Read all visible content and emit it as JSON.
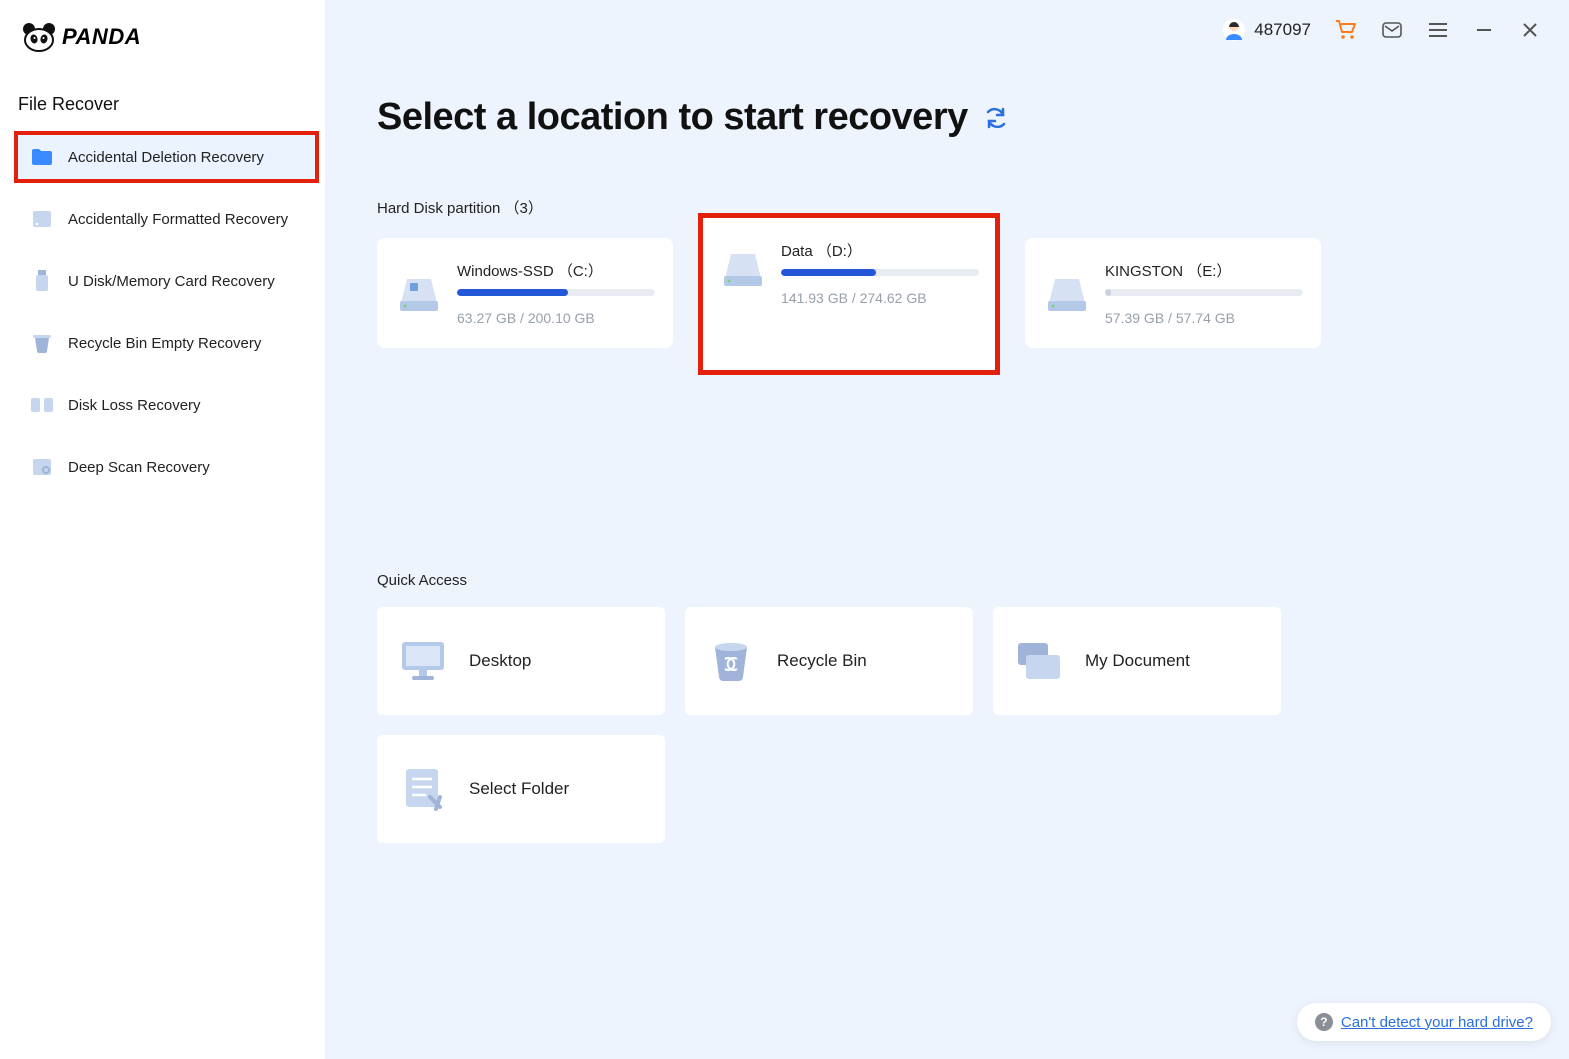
{
  "brand": {
    "name": "PANDA"
  },
  "header": {
    "user_id": "487097"
  },
  "sidebar": {
    "section_title": "File Recover",
    "items": [
      {
        "label": "Accidental Deletion Recovery",
        "icon": "folder-icon",
        "active": true,
        "highlighted": true
      },
      {
        "label": "Accidentally Formatted Recovery",
        "icon": "drive-small-icon"
      },
      {
        "label": "U Disk/Memory Card Recovery",
        "icon": "usb-icon"
      },
      {
        "label": "Recycle Bin Empty Recovery",
        "icon": "bin-icon"
      },
      {
        "label": "Disk Loss Recovery",
        "icon": "book-icon"
      },
      {
        "label": "Deep Scan Recovery",
        "icon": "scan-icon"
      }
    ]
  },
  "main": {
    "title": "Select a location to start recovery",
    "partitions_label": "Hard Disk partition （3）",
    "partitions": [
      {
        "name": "Windows-SSD （C:）",
        "used": "63.27 GB",
        "total": "200.10 GB",
        "pct": 56,
        "accent": "#2258d8"
      },
      {
        "name": "Data （D:）",
        "used": "141.93 GB",
        "total": "274.62 GB",
        "pct": 48,
        "highlighted": true,
        "accent": "#2258d8"
      },
      {
        "name": "KINGSTON （E:）",
        "used": "57.39 GB",
        "total": "57.74 GB",
        "pct": 1,
        "accent": "#dfe4ec"
      }
    ],
    "quick_access_label": "Quick Access",
    "quick_access": [
      {
        "label": "Desktop",
        "icon": "desktop"
      },
      {
        "label": "Recycle Bin",
        "icon": "recycle"
      },
      {
        "label": "My Document",
        "icon": "documents"
      },
      {
        "label": "Select Folder",
        "icon": "selectfolder"
      }
    ],
    "help_text": "Can't detect your hard drive?"
  },
  "colors": {
    "highlight_red": "#e3200c",
    "link_blue": "#2a6fe0",
    "progress_blue": "#2258d8",
    "cart_orange": "#ff7a1a"
  }
}
